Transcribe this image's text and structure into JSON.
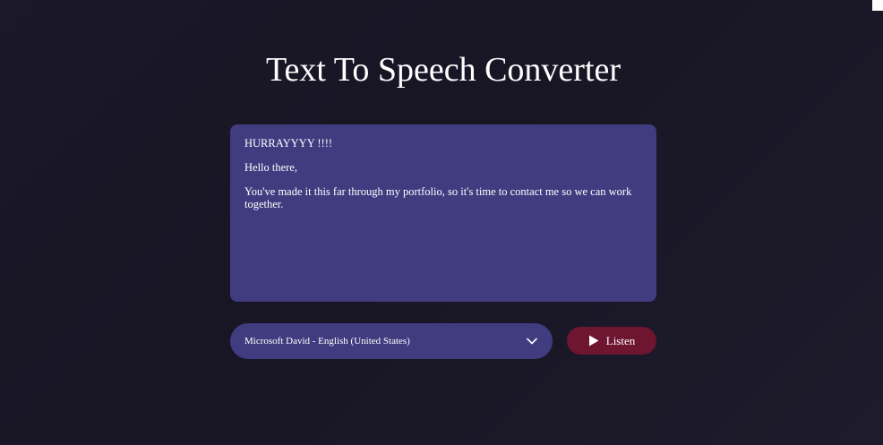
{
  "page": {
    "title": "Text To Speech Converter"
  },
  "editor": {
    "paragraphs": [
      "HURRAYYYY !!!!",
      "Hello there,",
      "You've made it this far through my portfolio, so it's time to contact me so we can work together."
    ]
  },
  "voice_select": {
    "selected_value": "Microsoft David - English (United States)",
    "icon": "chevron-down-icon"
  },
  "listen_button": {
    "label": "Listen",
    "icon": "play-icon"
  },
  "colors": {
    "background": "#1a1829",
    "panel": "#413c80",
    "button": "#6d1531",
    "text": "#ffffff"
  }
}
